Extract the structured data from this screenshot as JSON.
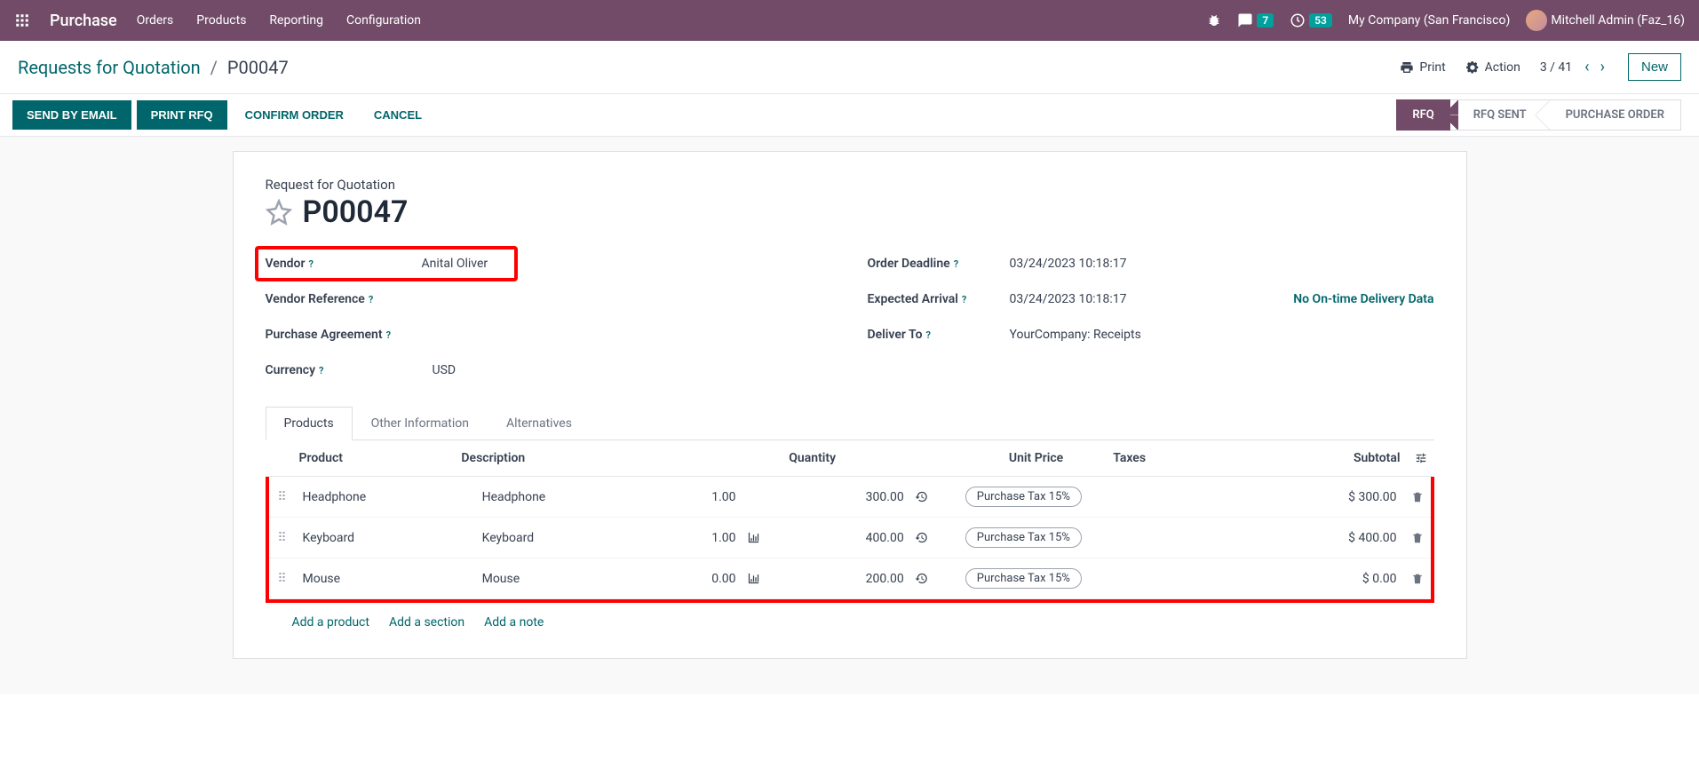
{
  "nav": {
    "brand": "Purchase",
    "menu": [
      "Orders",
      "Products",
      "Reporting",
      "Configuration"
    ],
    "messages_count": "7",
    "activities_count": "53",
    "company": "My Company (San Francisco)",
    "user": "Mitchell Admin (Faz_16)"
  },
  "breadcrumb": {
    "parent": "Requests for Quotation",
    "current": "P00047"
  },
  "controls": {
    "print": "Print",
    "action": "Action",
    "pager": "3 / 41",
    "new": "New"
  },
  "actions": {
    "send_email": "SEND BY EMAIL",
    "print_rfq": "PRINT RFQ",
    "confirm": "CONFIRM ORDER",
    "cancel": "CANCEL"
  },
  "flow": {
    "rfq": "RFQ",
    "rfq_sent": "RFQ SENT",
    "po": "PURCHASE ORDER"
  },
  "form": {
    "subtitle": "Request for Quotation",
    "title": "P00047",
    "labels": {
      "vendor": "Vendor",
      "vendor_ref": "Vendor Reference",
      "agreement": "Purchase Agreement",
      "currency": "Currency",
      "deadline": "Order Deadline",
      "arrival": "Expected Arrival",
      "deliver": "Deliver To"
    },
    "values": {
      "vendor": "Anital Oliver",
      "vendor_ref": "",
      "agreement": "",
      "currency": "USD",
      "deadline": "03/24/2023 10:18:17",
      "arrival": "03/24/2023 10:18:17",
      "deliver": "YourCompany: Receipts"
    },
    "ontime": "No On-time Delivery Data"
  },
  "tabs": {
    "products": "Products",
    "other": "Other Information",
    "alt": "Alternatives"
  },
  "table": {
    "headers": {
      "product": "Product",
      "description": "Description",
      "quantity": "Quantity",
      "unit_price": "Unit Price",
      "taxes": "Taxes",
      "subtotal": "Subtotal"
    },
    "rows": [
      {
        "product": "Headphone",
        "description": "Headphone",
        "quantity": "1.00",
        "forecast": false,
        "unit_price": "300.00",
        "tax": "Purchase Tax 15%",
        "subtotal": "$ 300.00"
      },
      {
        "product": "Keyboard",
        "description": "Keyboard",
        "quantity": "1.00",
        "forecast": true,
        "unit_price": "400.00",
        "tax": "Purchase Tax 15%",
        "subtotal": "$ 400.00"
      },
      {
        "product": "Mouse",
        "description": "Mouse",
        "quantity": "0.00",
        "forecast": true,
        "unit_price": "200.00",
        "tax": "Purchase Tax 15%",
        "subtotal": "$ 0.00"
      }
    ],
    "add_product": "Add a product",
    "add_section": "Add a section",
    "add_note": "Add a note"
  }
}
